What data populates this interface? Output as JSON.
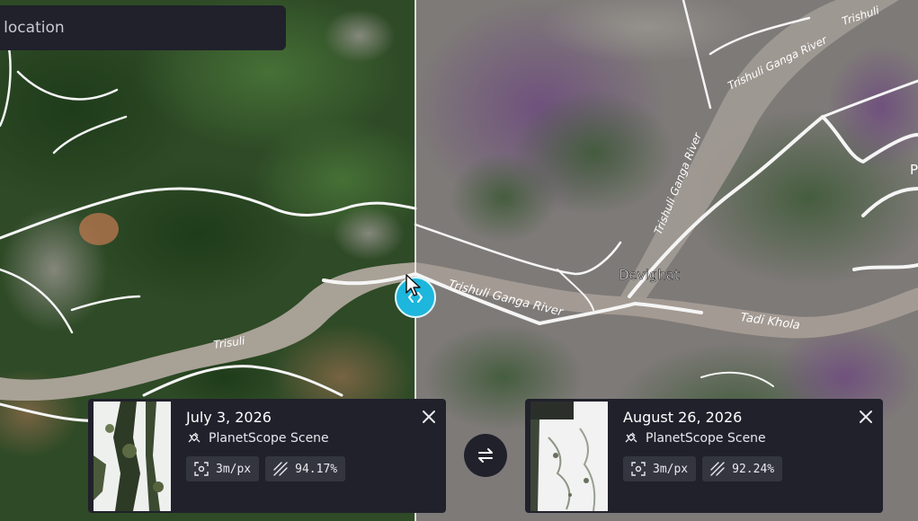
{
  "search": {
    "placeholder": "n location"
  },
  "map": {
    "labels": {
      "river_trishuli_short": "Trisuli",
      "river_trishuli_main": "Trishuli Ganga River",
      "river_trishuli_north": "Trishuli Ganga River",
      "river_trishuli_top": "Trishuli Ganga River",
      "river_trishuli_far": "Trishuli",
      "river_trishuli_vertical": "Trishuli Ganga River",
      "place_devighat": "Devighat",
      "river_tadi": "Tadi Khola",
      "edge_p": "P"
    }
  },
  "compare": {
    "left": {
      "date": "July 3, 2026",
      "source": "PlanetScope Scene",
      "resolution": "3m/px",
      "coverage": "94.17%"
    },
    "right": {
      "date": "August 26, 2026",
      "source": "PlanetScope Scene",
      "resolution": "3m/px",
      "coverage": "92.24%"
    }
  },
  "colors": {
    "accent": "#1db6dc",
    "panel": "#20212b",
    "pill": "#33353f"
  },
  "icons": [
    "satellite-icon",
    "resolution-icon",
    "coverage-icon",
    "close-icon",
    "swap-icon",
    "compare-handle-icon",
    "cursor-icon"
  ]
}
